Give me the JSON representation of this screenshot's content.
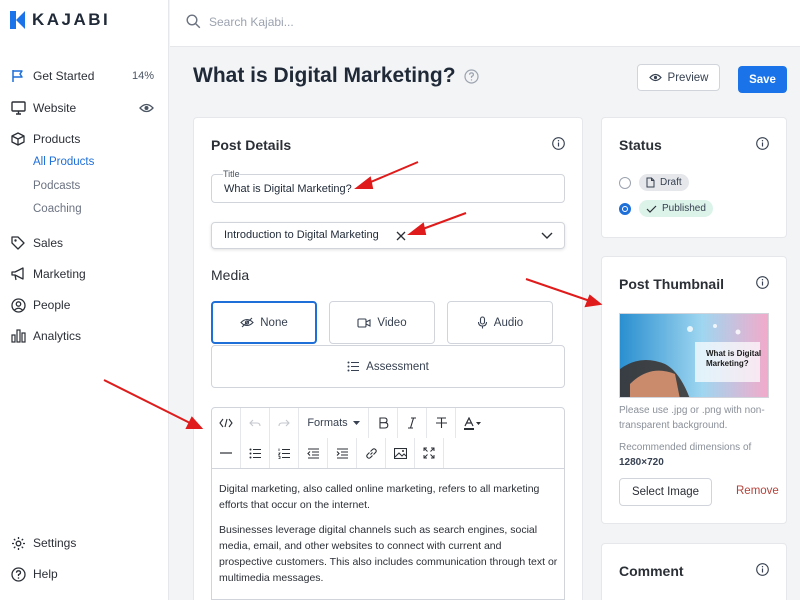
{
  "brand": {
    "name": "KAJABI",
    "accent": "#1a73e8"
  },
  "search": {
    "placeholder": "Search Kajabi..."
  },
  "sidebar": {
    "items": [
      {
        "label": "Get Started",
        "right": "14%",
        "icon": "flag-icon"
      },
      {
        "label": "Website",
        "icon": "monitor-icon"
      },
      {
        "label": "Products",
        "icon": "box-icon"
      },
      {
        "label": "Sales",
        "icon": "tag-icon"
      },
      {
        "label": "Marketing",
        "icon": "megaphone-icon"
      },
      {
        "label": "People",
        "icon": "person-icon"
      },
      {
        "label": "Analytics",
        "icon": "bar-chart-icon"
      }
    ],
    "product_sub": [
      "All Products",
      "Podcasts",
      "Coaching"
    ],
    "bottom": [
      {
        "label": "Settings",
        "icon": "gear-icon"
      },
      {
        "label": "Help",
        "icon": "help-icon"
      }
    ]
  },
  "header": {
    "title": "What is Digital Marketing?",
    "preview_label": "Preview",
    "save_label": "Save"
  },
  "post_details": {
    "heading": "Post Details",
    "title_label": "Title",
    "title_value": "What is Digital Marketing?",
    "category_value": "Introduction to Digital Marketing",
    "media_heading": "Media",
    "media_options": [
      "None",
      "Video",
      "Audio",
      "Assessment"
    ],
    "media_selected": "None",
    "formats_label": "Formats",
    "body_paragraphs": [
      "Digital marketing, also called online marketing, refers to all marketing efforts that occur on the internet.",
      "Businesses leverage digital channels such as search engines, social media, email, and other websites to connect with current and prospective customers. This also includes communication through text or multimedia messages."
    ]
  },
  "status": {
    "heading": "Status",
    "options": [
      "Draft",
      "Published"
    ],
    "selected": "Published"
  },
  "thumbnail": {
    "heading": "Post Thumbnail",
    "image_caption": "What is Digital Marketing?",
    "help_text": "Please use .jpg or .png with non-transparent background.",
    "dims_label": "Recommended dimensions of",
    "dims_value": "1280×720",
    "select_label": "Select Image",
    "remove_label": "Remove"
  },
  "comment": {
    "heading": "Comment"
  },
  "colors": {
    "annotation_arrow": "#e01b1b",
    "published_pill": "#dcf3ea",
    "link_blue": "#1f6fd8"
  }
}
